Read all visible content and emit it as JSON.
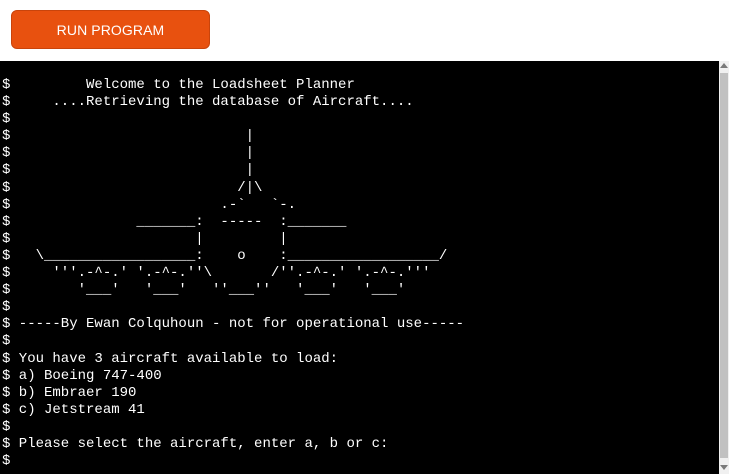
{
  "toolbar": {
    "run_label": "RUN PROGRAM"
  },
  "colors": {
    "run_button": "#e8510f",
    "terminal_bg": "#000000",
    "terminal_fg": "#ffffff"
  },
  "terminal": {
    "lines": [
      "$         Welcome to the Loadsheet Planner",
      "$     ....Retrieving the database of Aircraft....",
      "$",
      "$                            |",
      "$                            |",
      "$                            |",
      "$                           /|\\",
      "$                         .-`   `-.",
      "$               _______:  -----  :_______",
      "$                      |         |",
      "$   \\__________________:    o    :__________________/",
      "$     '''.-^-.' '.-^-.''\\       /''.-^-.' '.-^-.'''",
      "$        '___'   '___'   ''___''   '___'   '___'",
      "$",
      "$ -----By Ewan Colquhoun - not for operational use-----",
      "$",
      "$ You have 3 aircraft available to load:",
      "$ a) Boeing 747-400",
      "$ b) Embraer 190",
      "$ c) Jetstream 41",
      "$",
      "$ Please select the aircraft, enter a, b or c:",
      "$"
    ]
  }
}
